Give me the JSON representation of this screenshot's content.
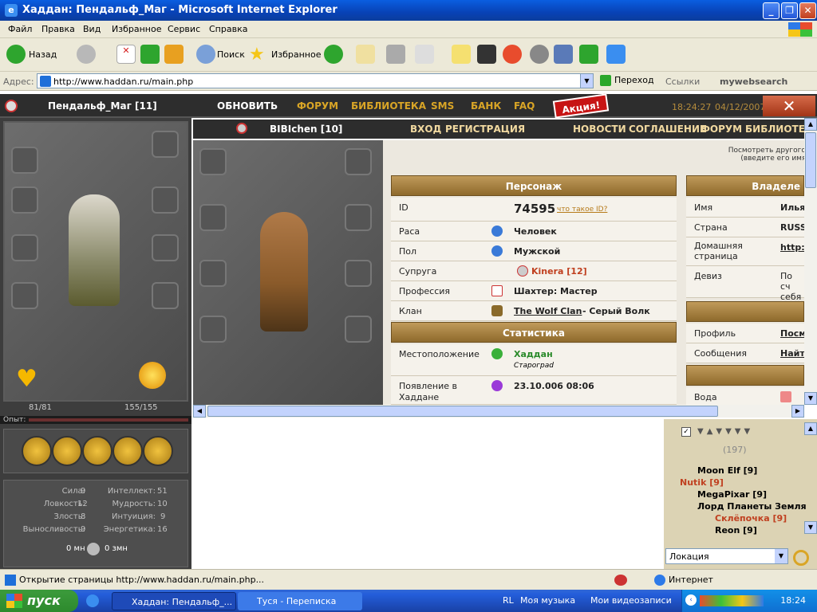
{
  "window": {
    "title": "Хаддан: Пендальф_Маг - Microsoft Internet Explorer"
  },
  "menu": [
    "Файл",
    "Правка",
    "Вид",
    "Избранное",
    "Сервис",
    "Справка"
  ],
  "toolbar": {
    "back": "Назад",
    "search": "Поиск",
    "favorites": "Избранное"
  },
  "address": {
    "label": "Адрес:",
    "url": "http://www.haddan.ru/main.php",
    "go": "Переход",
    "links": "Ссылки",
    "mywebsearch": "mywebsearch"
  },
  "topnav": {
    "player": "Пендальф_Маг [11]",
    "refresh": "ОБНОВИТЬ",
    "forum": "ФОРУМ",
    "library": "БИБЛИОТЕКА",
    "sms": "SMS",
    "bank": "БАНК",
    "faq": "FAQ",
    "promo": "Акция!",
    "time": "18:24:27",
    "date": "04/12/2007"
  },
  "left": {
    "hp": "81/81",
    "mana": "155/155",
    "exp_label": "Опыт:",
    "stats": [
      {
        "k": "Сила:",
        "v": "9"
      },
      {
        "k": "Ловкость:",
        "v": "12"
      },
      {
        "k": "Злость:",
        "v": "8"
      },
      {
        "k": "Выносливость:",
        "v": "9"
      }
    ],
    "stats2": [
      {
        "k": "Интеллект:",
        "v": "51"
      },
      {
        "k": "Мудрость:",
        "v": "10"
      },
      {
        "k": "Интуиция:",
        "v": "9"
      },
      {
        "k": "Энергетика:",
        "v": "16"
      }
    ],
    "money1": "0 мн",
    "money2": "0 змн"
  },
  "center": {
    "player": "BIBIchen [10]",
    "login": "ВХОД",
    "register": "РЕГИСТРАЦИЯ",
    "nav": [
      "НОВОСТИ",
      "СОГЛАШЕНИЕ",
      "ФОРУМ",
      "БИБЛИОТЕК"
    ],
    "lookup": "Посмотреть другого персонажа (введите его имя или ID):",
    "lookup_btn": ">>",
    "section_person": "Персонаж",
    "section_stats": "Статистика",
    "section_owner": "Владеле",
    "id_label": "ID",
    "id_value": "74595",
    "id_link": "что такое ID?",
    "race_label": "Раса",
    "race": "Человек",
    "sex_label": "Пол",
    "sex": "Мужской",
    "spouse_label": "Супруга",
    "spouse": "Kinera [12]",
    "prof_label": "Профессия",
    "prof": "Шахтер: Мастер",
    "clan_label": "Клан",
    "clan": "The Wolf Clan",
    "clan_suffix": "- Серый Волк",
    "loc_label": "Местоположение",
    "loc": "Хаддан",
    "loc_sub": "Старограd",
    "appear_label": "Появление в Хаддане",
    "appear": "23.10.006 08:06",
    "owner_rows": [
      {
        "k": "Имя",
        "v": "Илья"
      },
      {
        "k": "Страна",
        "v": "RUSS"
      },
      {
        "k": "Домашняя страница",
        "v": "http:"
      },
      {
        "k": "Девиз",
        "v": "По сч себя"
      }
    ],
    "extra_rows": [
      {
        "k": "Профиль",
        "v": "Посм"
      },
      {
        "k": "Сообщения",
        "v": "Найт"
      }
    ],
    "water_label": "Вода"
  },
  "online": {
    "count": "(197)",
    "list": [
      "Moon Elf [9]",
      "Nutik [9]",
      "MegaPixar [9]",
      "Лорд Планеты Земля",
      "Склёпочка [9]",
      "Reon [9]"
    ]
  },
  "location_select": "Локация",
  "status": {
    "text": "Открытие страницы http://www.haddan.ru/main.php...",
    "zone": "Интернет"
  },
  "taskbar": {
    "start": "пуск",
    "task1": "Хаддан: Пендальф_...",
    "task2": "Туся - Переписка",
    "tb1": "RL",
    "tb2": "Моя музыка",
    "tb3": "Мои видеозаписи",
    "clock": "18:24"
  },
  "colors": {
    "accent": "#d9a526",
    "header": "#2d2d2d",
    "profile_bg": "#ece8df"
  }
}
